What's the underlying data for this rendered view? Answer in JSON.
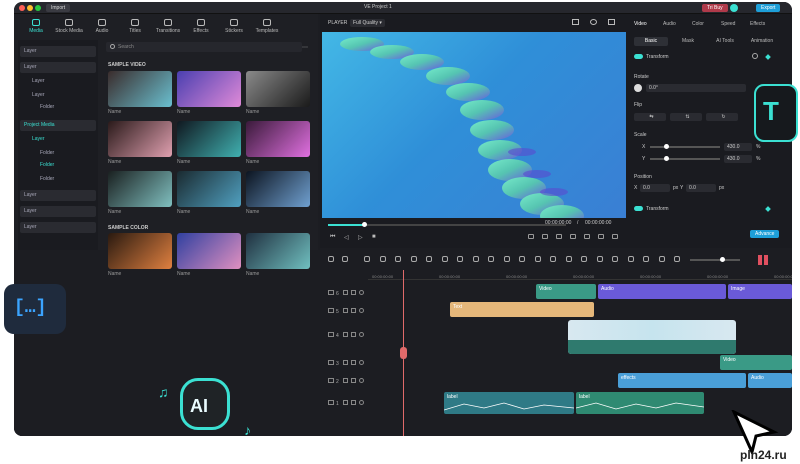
{
  "titlebar": {
    "import_label": "Import",
    "project_title": "VE Project 1",
    "buy_label": "Tri Buy",
    "export_label": "Export"
  },
  "tooltabs": [
    {
      "label": "Media",
      "icon": "media-icon",
      "active": true
    },
    {
      "label": "Stock Media",
      "icon": "stock-media-icon"
    },
    {
      "label": "Audio",
      "icon": "audio-icon"
    },
    {
      "label": "Titles",
      "icon": "titles-icon"
    },
    {
      "label": "Transitions",
      "icon": "transitions-icon"
    },
    {
      "label": "Effects",
      "icon": "effects-icon"
    },
    {
      "label": "Stickers",
      "icon": "stickers-icon"
    },
    {
      "label": "Templates",
      "icon": "templates-icon"
    }
  ],
  "tree": [
    {
      "label": "Layer",
      "indent": 0,
      "header": true
    },
    {
      "label": "Layer",
      "indent": 0,
      "header": true
    },
    {
      "label": "Layer",
      "indent": 1
    },
    {
      "label": "Layer",
      "indent": 1
    },
    {
      "label": "Folder",
      "indent": 2
    },
    {
      "label": "Project Media",
      "indent": 0,
      "header": true,
      "selected": true
    },
    {
      "label": "Layer",
      "indent": 1,
      "selected": true
    },
    {
      "label": "Folder",
      "indent": 2
    },
    {
      "label": "Folder",
      "indent": 2,
      "selected": true
    },
    {
      "label": "Folder",
      "indent": 2
    },
    {
      "label": "Layer",
      "indent": 0,
      "header": true
    },
    {
      "label": "Layer",
      "indent": 0,
      "header": true
    },
    {
      "label": "Layer",
      "indent": 0,
      "header": true
    }
  ],
  "media": {
    "search_placeholder": "Search",
    "sample_video_title": "SAMPLE VIDEO",
    "sample_color_title": "SAMPLE COLOR",
    "video_items": [
      "Name",
      "Name",
      "Name",
      "Name",
      "Name",
      "Name",
      "Name",
      "Name",
      "Name"
    ],
    "color_items": [
      "Name",
      "Name",
      "Name"
    ]
  },
  "player": {
    "label": "PLAYER",
    "quality": "Full Quality",
    "time_current": "00:00:00:00",
    "time_separator": "/",
    "time_total": "00:00:00:00"
  },
  "inspector": {
    "tabs": [
      "Video",
      "Audio",
      "Color",
      "Speed",
      "Effects"
    ],
    "subtabs": [
      "Basic",
      "Mask",
      "AI Tools",
      "Animation"
    ],
    "transform_label": "Transform",
    "rotate_label": "Rotate",
    "rotate_value": "0.0°",
    "flip_label": "Flip",
    "scale_label": "Scale",
    "scale_x_label": "X",
    "scale_y_label": "Y",
    "scale_x_value": "430.0",
    "scale_y_value": "430.0",
    "scale_unit": "%",
    "position_label": "Position",
    "pos_x_label": "X",
    "pos_x_value": "0.0",
    "pos_y_label": "Y",
    "pos_y_value": "0.0",
    "pos_unit": "px",
    "transform2_label": "Transform",
    "advance_label": "Advance"
  },
  "timeline": {
    "ruler": [
      "00:00:00:00",
      "00:00:00:00",
      "00:00:00:00",
      "00:00:00:00",
      "00:00:00:00",
      "00:00:00:00",
      "00:00:00:00"
    ],
    "clips": {
      "video1": "Video",
      "audio1": "Audio",
      "image1": "Image",
      "text1": "Text",
      "video2": "Video",
      "effects": "effects",
      "audio2": "Audio",
      "label1": "label",
      "label2": "label"
    },
    "track_numbers": [
      "6",
      "5",
      "4",
      "3",
      "2",
      "1",
      "2"
    ]
  },
  "overlays": {
    "ai_label": "AI",
    "watermark": "pln24.ru"
  },
  "colors": {
    "accent": "#3be0d2",
    "clip_audio": "#6a5ad8",
    "clip_video": "#3a9a86",
    "clip_text": "#e5b77a",
    "clip_effects": "#4a9fd8"
  }
}
